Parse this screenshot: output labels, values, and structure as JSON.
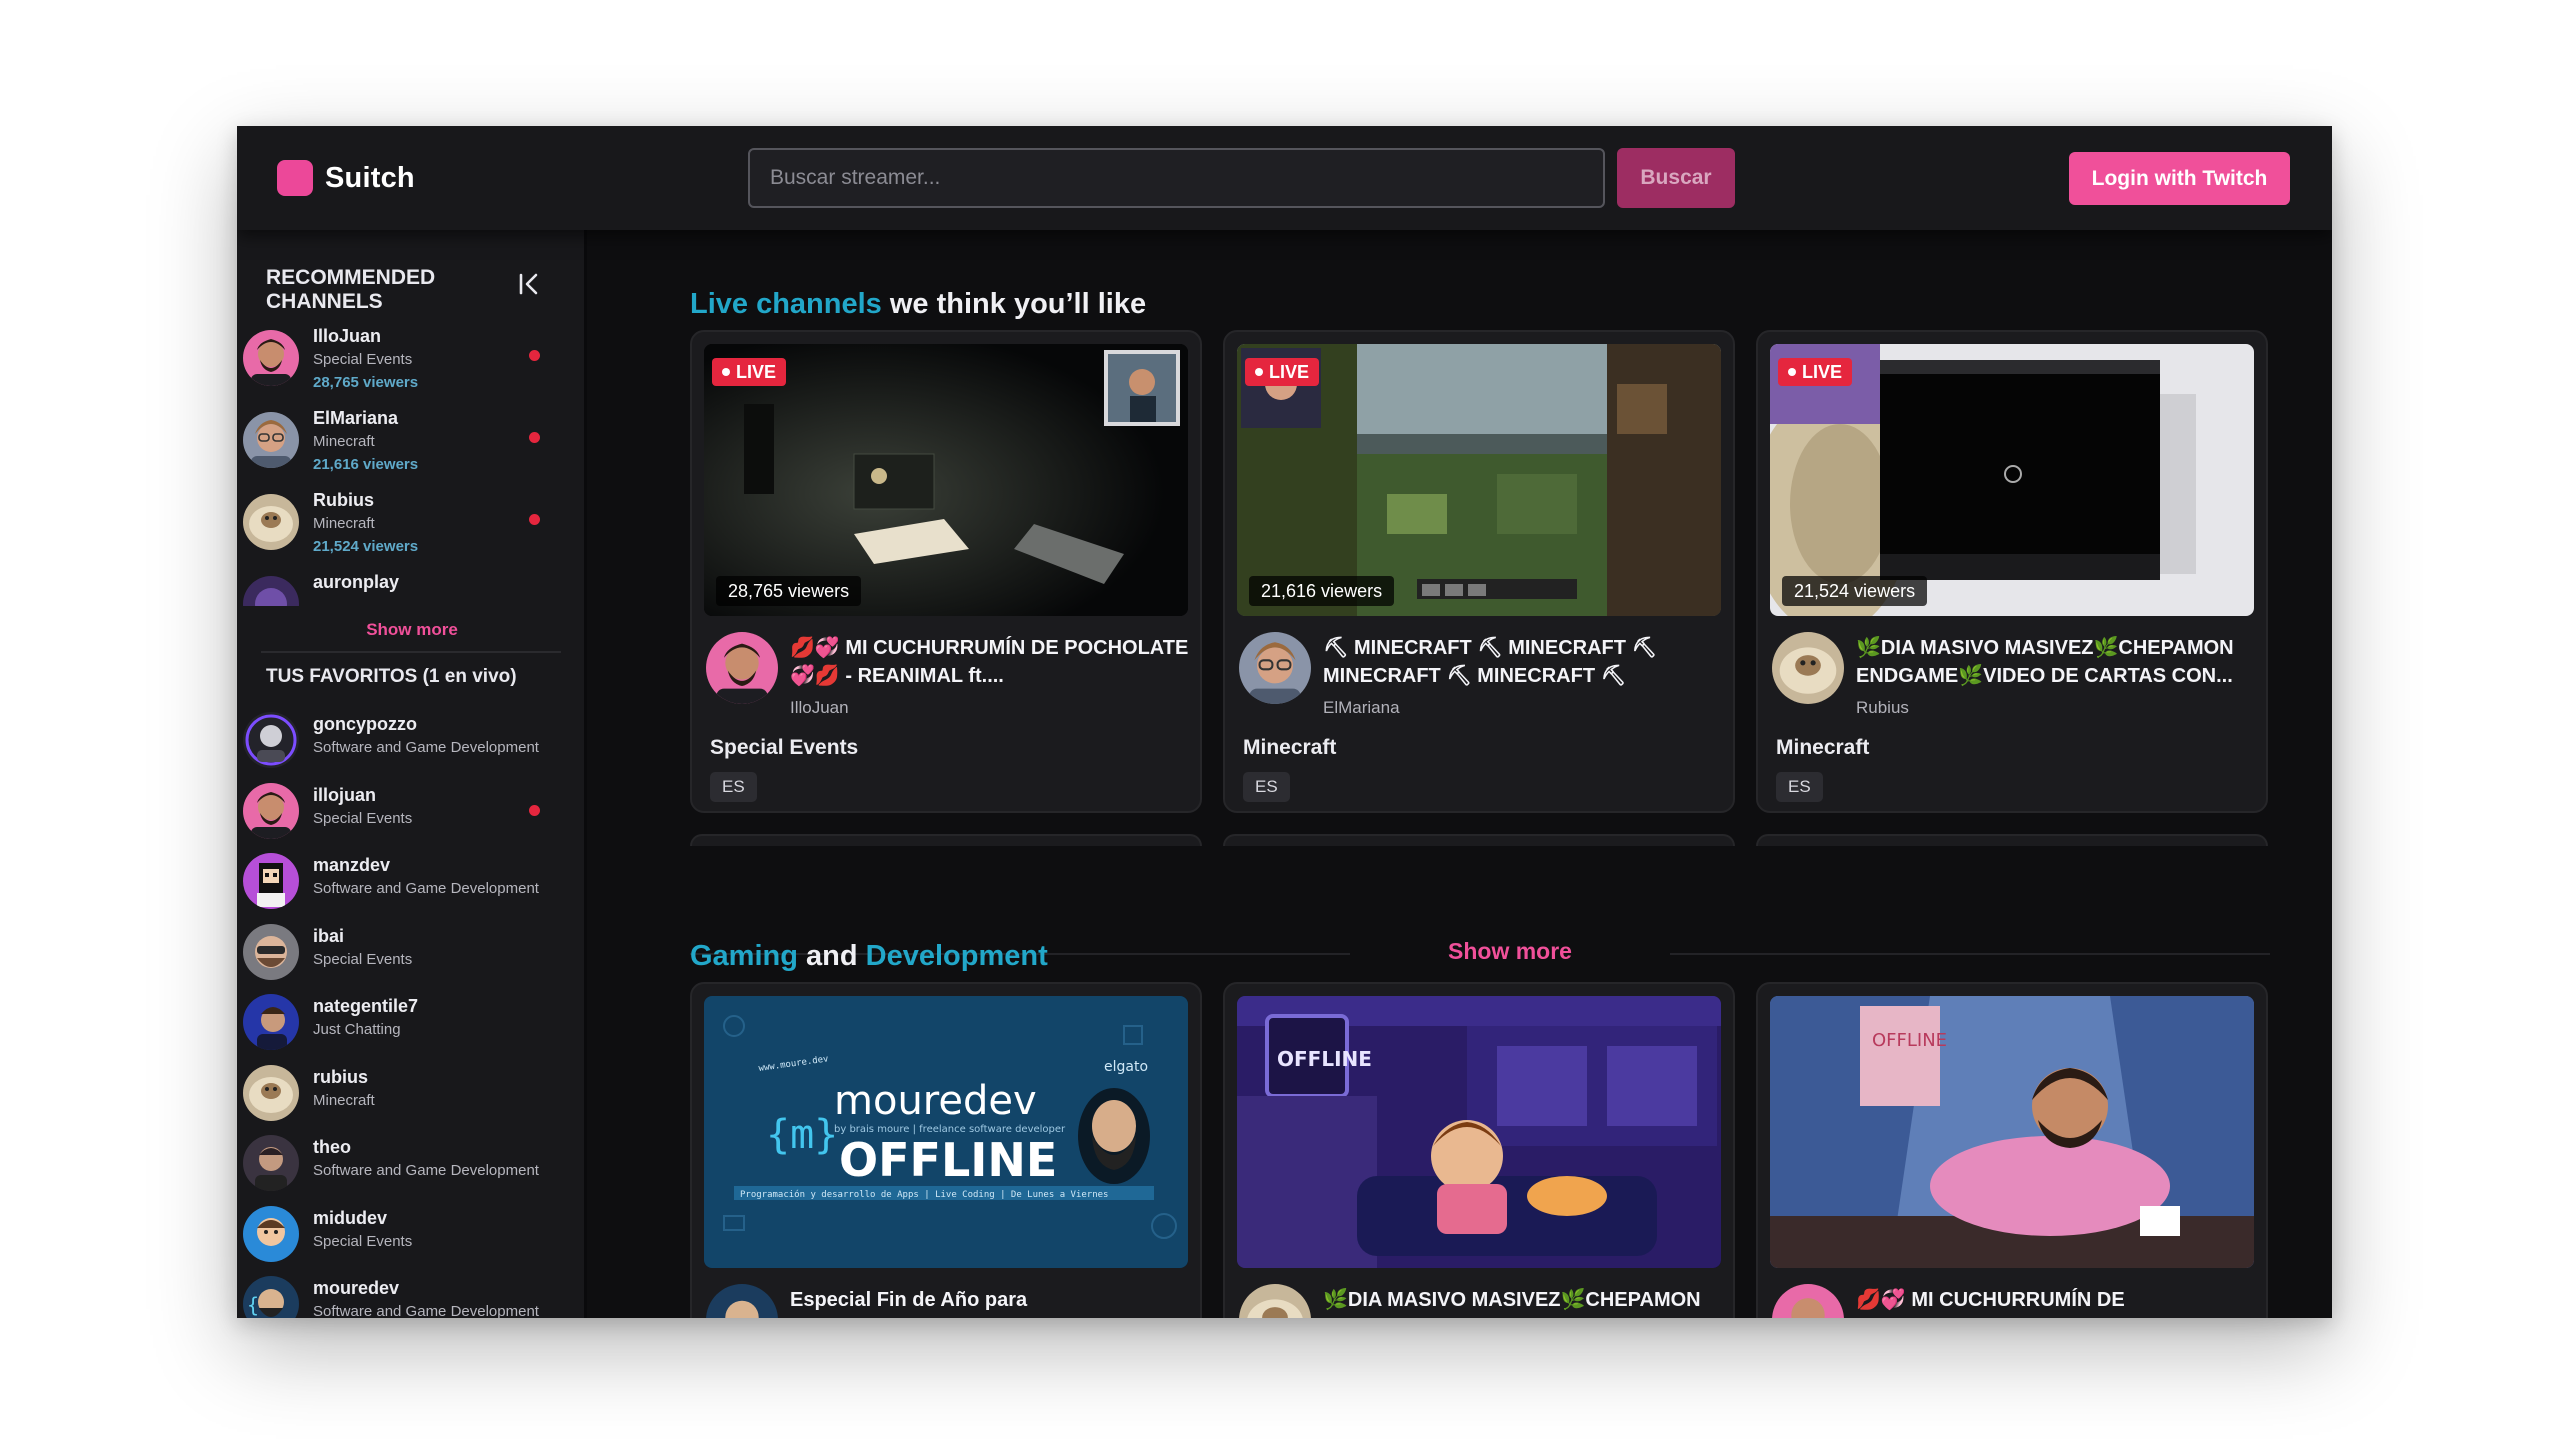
{
  "app": {
    "name": "Suitch"
  },
  "header": {
    "search_placeholder": "Buscar streamer...",
    "search_button": "Buscar",
    "login_button": "Login with Twitch"
  },
  "sidebar": {
    "recommended_heading": "RECOMMENDED CHANNELS",
    "recommended": [
      {
        "name": "IlloJuan",
        "category": "Special Events",
        "viewers": "28,765 viewers",
        "live": true
      },
      {
        "name": "ElMariana",
        "category": "Minecraft",
        "viewers": "21,616 viewers",
        "live": true
      },
      {
        "name": "Rubius",
        "category": "Minecraft",
        "viewers": "21,524 viewers",
        "live": true
      },
      {
        "name": "auronplay",
        "category": "",
        "viewers": "",
        "live": false
      }
    ],
    "show_more": "Show more",
    "favorites_heading": "TUS FAVORITOS (1 en vivo)",
    "favorites": [
      {
        "name": "goncypozzo",
        "category": "Software and Game Development",
        "live": false
      },
      {
        "name": "illojuan",
        "category": "Special Events",
        "live": true
      },
      {
        "name": "manzdev",
        "category": "Software and Game Development",
        "live": false
      },
      {
        "name": "ibai",
        "category": "Special Events",
        "live": false
      },
      {
        "name": "nategentile7",
        "category": "Just Chatting",
        "live": false
      },
      {
        "name": "rubius",
        "category": "Minecraft",
        "live": false
      },
      {
        "name": "theo",
        "category": "Software and Game Development",
        "live": false
      },
      {
        "name": "midudev",
        "category": "Special Events",
        "live": false
      },
      {
        "name": "mouredev",
        "category": "Software and Game Development",
        "live": false
      }
    ]
  },
  "main": {
    "live_section": {
      "accent": "Live channels",
      "rest": " we think you’ll like"
    },
    "live_cards": [
      {
        "live_label": "LIVE",
        "viewers": "28,765 viewers",
        "title": "💋💞 MI CUCHURRUMÍN DE POCHOLATE 💞💋 - REANIMAL ft....",
        "streamer": "IlloJuan",
        "category": "Special Events",
        "tag": "ES"
      },
      {
        "live_label": "LIVE",
        "viewers": "21,616 viewers",
        "title": "⛏ MINECRAFT ⛏ MINECRAFT ⛏ MINECRAFT ⛏ MINECRAFT ⛏",
        "streamer": "ElMariana",
        "category": "Minecraft",
        "tag": "ES"
      },
      {
        "live_label": "LIVE",
        "viewers": "21,524 viewers",
        "title": "🌿DIA MASIVO MASIVEZ🌿CHEPAMON ENDGAME🌿VIDEO DE CARTAS CON...",
        "streamer": "Rubius",
        "category": "Minecraft",
        "tag": "ES"
      }
    ],
    "show_more": "Show more",
    "gaming_section": {
      "accent1": "Gaming",
      "middle": " and ",
      "accent2": "Development"
    },
    "gaming_cards": [
      {
        "title": "Especial Fin de Año para",
        "offline_brand": "mouredev",
        "offline_word": "OFFLINE",
        "offline_sub": "by brais moure | freelance software developer",
        "offline_strip": "Programación y desarrollo de Apps | Live Coding | De Lunes a Viernes",
        "offline_logo": "{m}",
        "offline_handle": "www.moure.dev",
        "offline_partner": "elgato"
      },
      {
        "title": "🌿DIA MASIVO MASIVEZ🌿CHEPAMON",
        "offline_word": "OFFLINE"
      },
      {
        "title": "💋💞 MI CUCHURRUMÍN DE",
        "offline_word": "OFFLINE"
      }
    ]
  },
  "colors": {
    "brand": "#ec4899",
    "accent_blue": "#22a7c9",
    "live_red": "#e5263e",
    "background": "#0e0e10",
    "panel": "#18181b"
  }
}
